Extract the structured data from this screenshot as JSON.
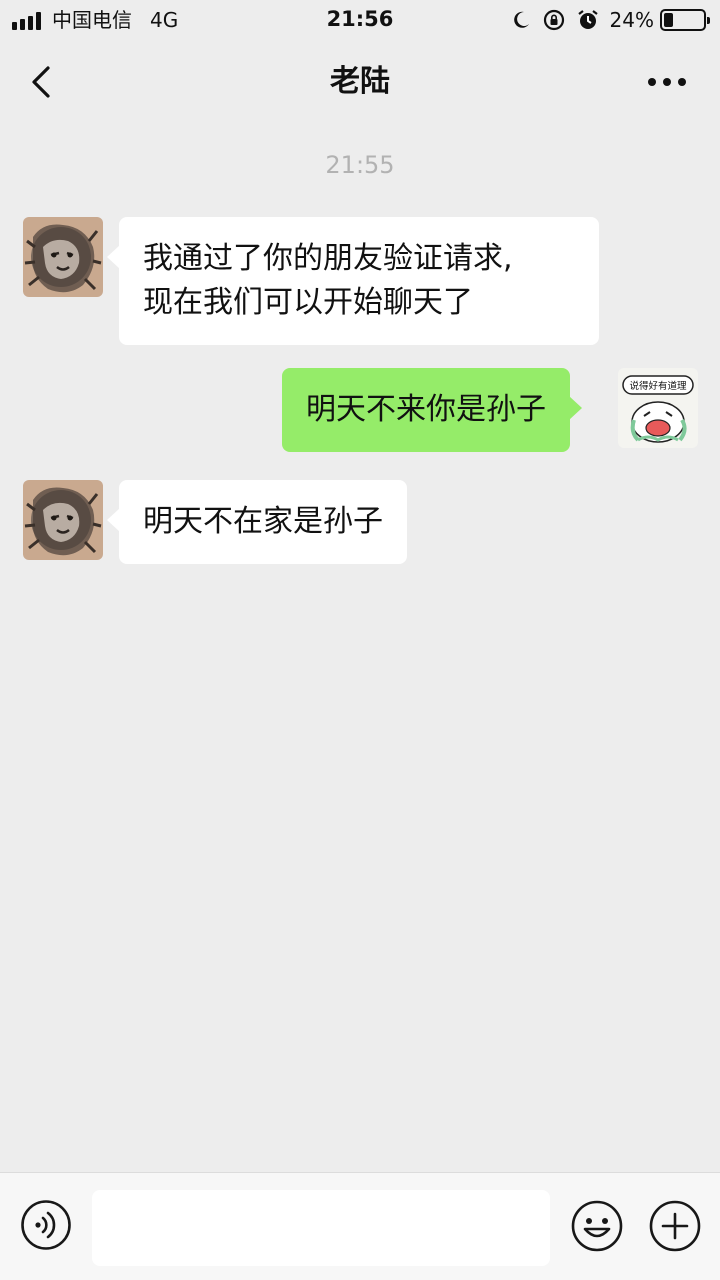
{
  "status_bar": {
    "carrier": "中国电信",
    "network": "4G",
    "time": "21:56",
    "battery_percent": 24,
    "battery_text": "24%",
    "icons": [
      "signal-icon",
      "moon-icon",
      "rotation-lock-icon",
      "alarm-icon",
      "battery-icon"
    ]
  },
  "nav": {
    "title": "老陆",
    "back_icon": "chevron-left-icon",
    "more_icon": "more-dots-icon"
  },
  "chat": {
    "timestamp": "21:55",
    "messages": [
      {
        "direction": "incoming",
        "lines": [
          "我通过了你的朋友验证请求,",
          "现在我们可以开始聊天了"
        ],
        "avatar": "lion-avatar"
      },
      {
        "direction": "outgoing",
        "text": "明天不来你是孙子",
        "avatar": "cartoon-avatar",
        "avatar_caption": "说得好有道理"
      },
      {
        "direction": "incoming",
        "text": "明天不在家是孙子",
        "avatar": "lion-avatar"
      }
    ]
  },
  "input_bar": {
    "voice_icon": "voice-icon",
    "input_value": "",
    "emoji_icon": "emoji-icon",
    "plus_icon": "plus-icon"
  },
  "colors": {
    "background": "#ededed",
    "incoming_bubble": "#ffffff",
    "outgoing_bubble": "#95ec69",
    "timestamp": "#b2b2b2"
  }
}
